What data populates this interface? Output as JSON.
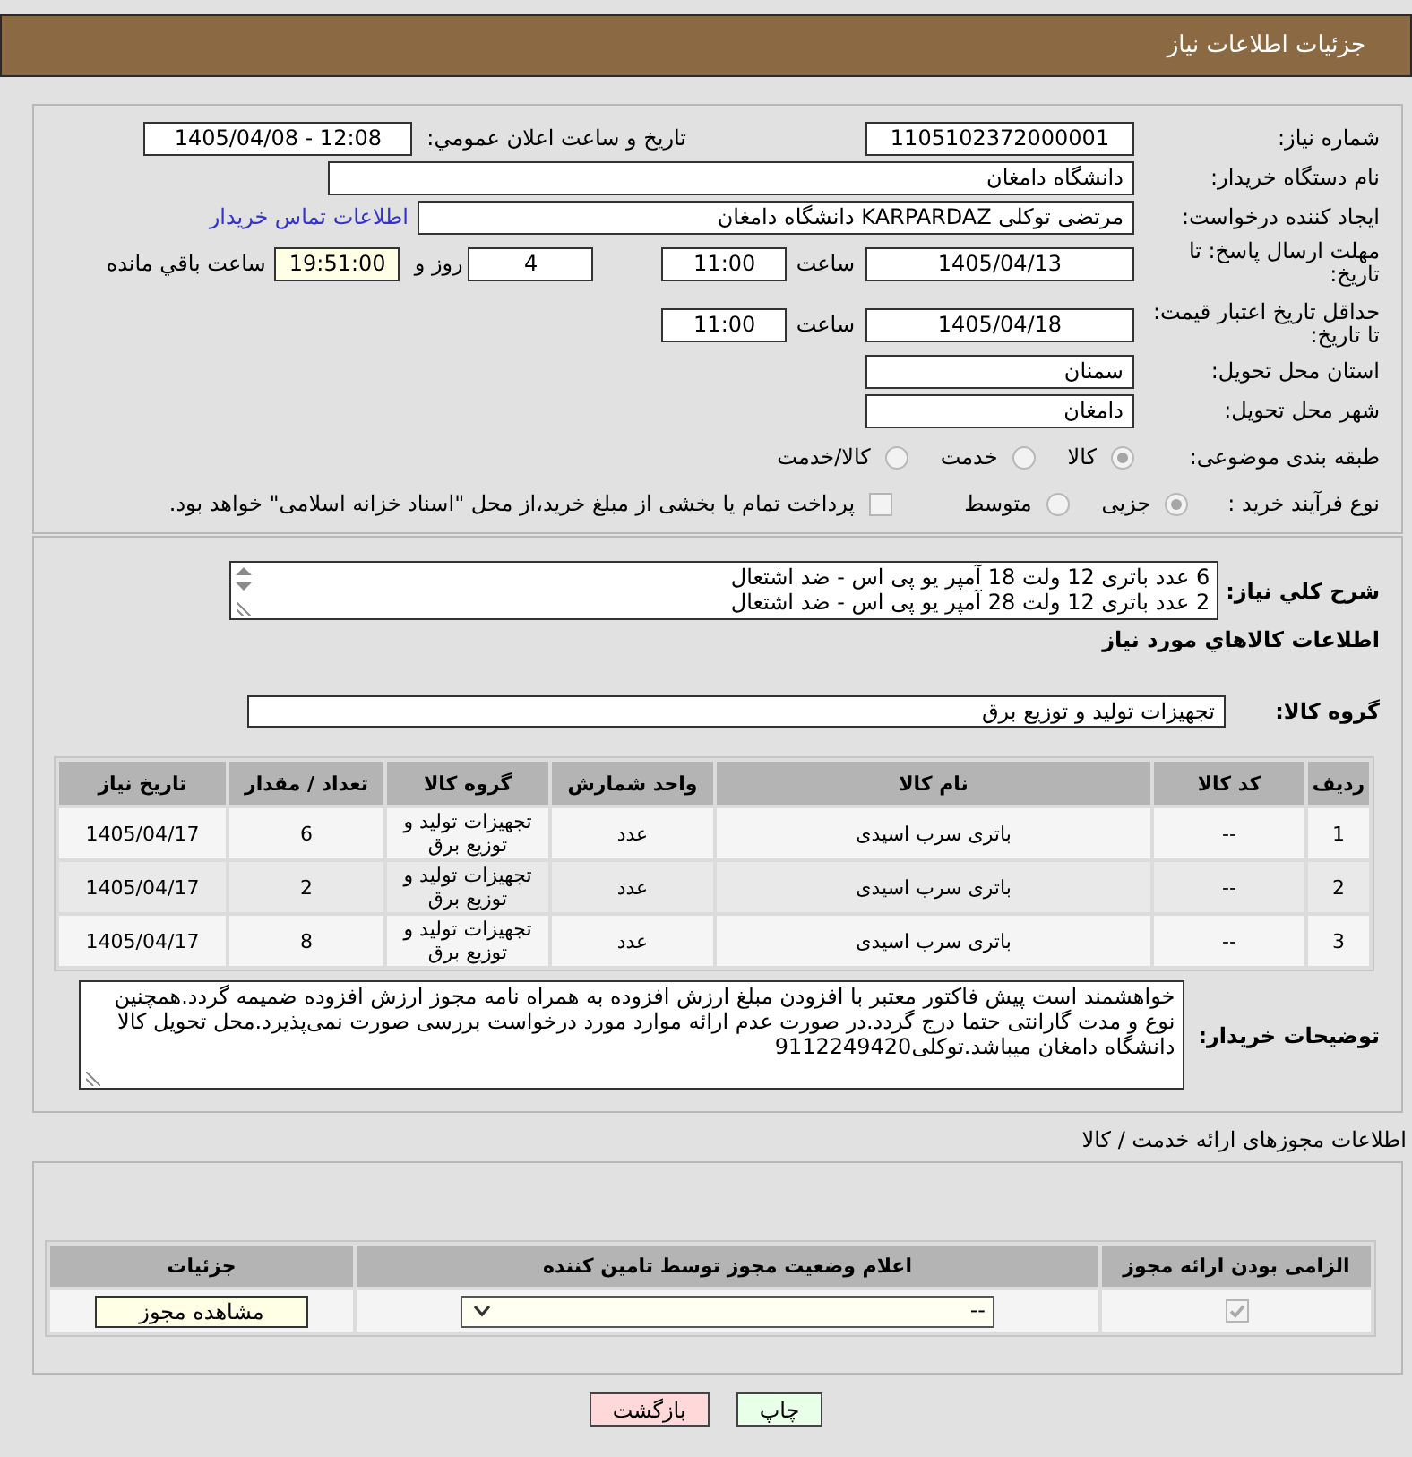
{
  "header": {
    "title": "جزئیات اطلاعات نیاز"
  },
  "form": {
    "need_number": {
      "label": "شماره نیاز:",
      "value": "1105102372000001"
    },
    "announcement": {
      "label": "تاریخ و ساعت اعلان عمومي:",
      "value": "1405/04/08 - 12:08"
    },
    "buyer": {
      "label": "نام دستگاه خریدار:",
      "value": "دانشگاه دامغان"
    },
    "requester": {
      "label": "ایجاد کننده درخواست:",
      "value": "مرتضی توکلی KARPARDAZ دانشگاه دامغان",
      "contact_link": "اطلاعات تماس خریدار"
    },
    "reply_deadline": {
      "label": "مهلت ارسال پاسخ: تا تاریخ:",
      "date": "1405/04/13",
      "time_label": "ساعت",
      "time": "11:00",
      "days": "4",
      "days_label": "روز و",
      "remaining": "19:51:00",
      "remaining_label": "ساعت باقي مانده"
    },
    "price_validity": {
      "label": "حداقل تاریخ اعتبار قیمت: تا تاریخ:",
      "date": "1405/04/18",
      "time_label": "ساعت",
      "time": "11:00"
    },
    "province": {
      "label": "استان محل تحویل:",
      "value": "سمنان"
    },
    "city": {
      "label": "شهر محل تحویل:",
      "value": "دامغان"
    },
    "category": {
      "label": "طبقه بندی موضوعی:",
      "options": [
        {
          "label": "کالا",
          "selected": true
        },
        {
          "label": "خدمت",
          "selected": false
        },
        {
          "label": "کالا/خدمت",
          "selected": false
        }
      ]
    },
    "purchase_type": {
      "label": "نوع فرآیند خرید :",
      "options": [
        {
          "label": "جزیی",
          "selected": true
        },
        {
          "label": "متوسط",
          "selected": false
        }
      ],
      "treasury": {
        "label": "پرداخت تمام یا بخشی از مبلغ خرید،از محل \"اسناد خزانه اسلامی\" خواهد بود.",
        "checked": false
      }
    }
  },
  "description": {
    "label": "شرح کلي نیاز:",
    "lines": [
      "6 عدد باتری 12 ولت 18 آمپر یو پی اس - ضد اشتعال",
      "2 عدد باتری 12 ولت 28 آمپر یو پی اس - ضد اشتعال"
    ]
  },
  "goods": {
    "title": "اطلاعات کالاهاي مورد نیاز",
    "group_label": "گروه کالا:",
    "group": "تجهیزات تولید و توزیع برق",
    "columns": [
      "ردیف",
      "کد کالا",
      "نام کالا",
      "واحد شمارش",
      "گروه کالا",
      "تعداد / مقدار",
      "تاریخ نیاز"
    ],
    "rows": [
      [
        "1",
        "--",
        "باتری سرب اسیدی",
        "عدد",
        "تجهیزات تولید و توزیع برق",
        "6",
        "1405/04/17"
      ],
      [
        "2",
        "--",
        "باتری سرب اسیدی",
        "عدد",
        "تجهیزات تولید و توزیع برق",
        "2",
        "1405/04/17"
      ],
      [
        "3",
        "--",
        "باتری سرب اسیدی",
        "عدد",
        "تجهیزات تولید و توزیع برق",
        "8",
        "1405/04/17"
      ]
    ]
  },
  "buyer_notes": {
    "label": "توضیحات خریدار:",
    "text": "خواهشمند است پیش فاکتور معتبر با افزودن مبلغ ارزش افزوده به همراه نامه مجوز ارزش افزوده ضمیمه گردد.همچنین نوع و مدت گارانتی حتما درج گردد.در صورت عدم ارائه موارد مورد درخواست بررسی صورت نمی‌پذیرد.محل تحویل کالا دانشگاه دامغان میباشد.توکلی9112249420"
  },
  "permits": {
    "title": "اطلاعات مجوزهای ارائه خدمت / کالا",
    "columns": [
      "الزامی بودن ارائه مجوز",
      "اعلام وضعیت مجوز توسط تامین کننده",
      "جزئیات"
    ],
    "rows": [
      {
        "required": true,
        "status": "--",
        "action": "مشاهده مجوز"
      }
    ]
  },
  "buttons": [
    {
      "label": "چاپ",
      "kind": "print"
    },
    {
      "label": "بازگشت",
      "kind": "back"
    }
  ]
}
